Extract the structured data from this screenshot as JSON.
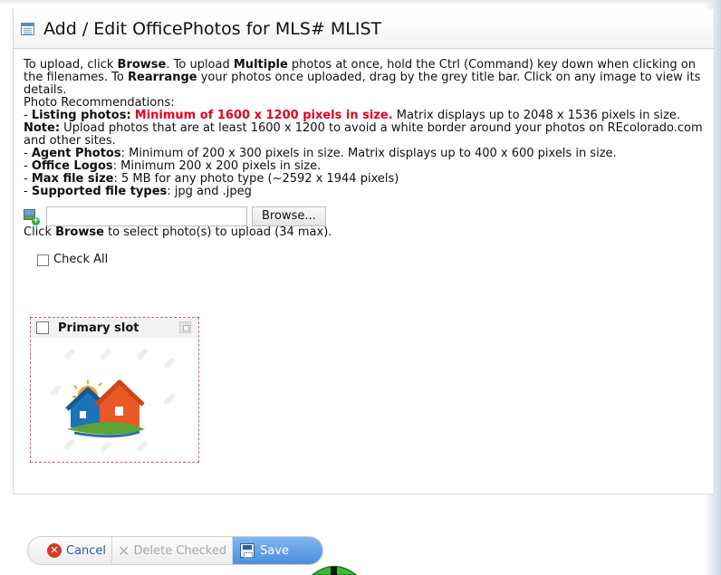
{
  "dialog": {
    "title": "Add / Edit OfficePhotos for MLS# MLIST"
  },
  "instructions": {
    "p1_a": "To upload, click ",
    "p1_browse": "Browse",
    "p1_b": ". To upload ",
    "p1_multiple": "Multiple",
    "p1_c": " photos at once, hold the Ctrl (Command) key down when clicking on the filenames. To ",
    "p1_rearrange": "Rearrange",
    "p1_d": " your photos once uploaded, drag by the grey title bar. Click on any image to view its details.",
    "recommendations_heading": "Photo Recommendations:",
    "listing_label": "Listing photos:",
    "listing_min": "Minimum of 1600 x 1200 pixels in size.",
    "listing_rest": " Matrix displays up to 2048 x 1536 pixels in size. ",
    "note_label": "Note:",
    "note_text": " Upload photos that are at least 1600 x 1200 to avoid a white border around your photos on REcolorado.com and other sites.",
    "agent_label": "Agent Photos",
    "agent_text": ": Minimum of 200 x 300 pixels in size. Matrix displays up to 400 x 600 pixels in size.",
    "logos_label": "Office Logos",
    "logos_text": ": Minimum 200 x 200 pixels in size.",
    "maxsize_label": "Max file size",
    "maxsize_text": ": 5 MB for any photo type (~2592 x 1944 pixels)",
    "types_label": "Supported file types",
    "types_text": ": jpg and .jpeg",
    "dash": "- "
  },
  "upload": {
    "file_value": "",
    "browse_label": "Browse...",
    "hint_a": "Click ",
    "hint_browse": "Browse",
    "hint_b": " to select photo(s) to upload (34 max)."
  },
  "photos": {
    "check_all_label": "Check All",
    "slot_label": "Primary slot"
  },
  "buttons": {
    "cancel": "Cancel",
    "delete_checked": "Delete Checked",
    "save": "Save"
  },
  "colors": {
    "accent_red": "#e3001b",
    "save_blue": "#4c8fdd",
    "slot_border": "#e3565a"
  },
  "icons": [
    "table-icon",
    "add-photo-icon",
    "expand-icon",
    "cancel-icon",
    "delete-icon",
    "save-icon",
    "cursor-icon"
  ]
}
